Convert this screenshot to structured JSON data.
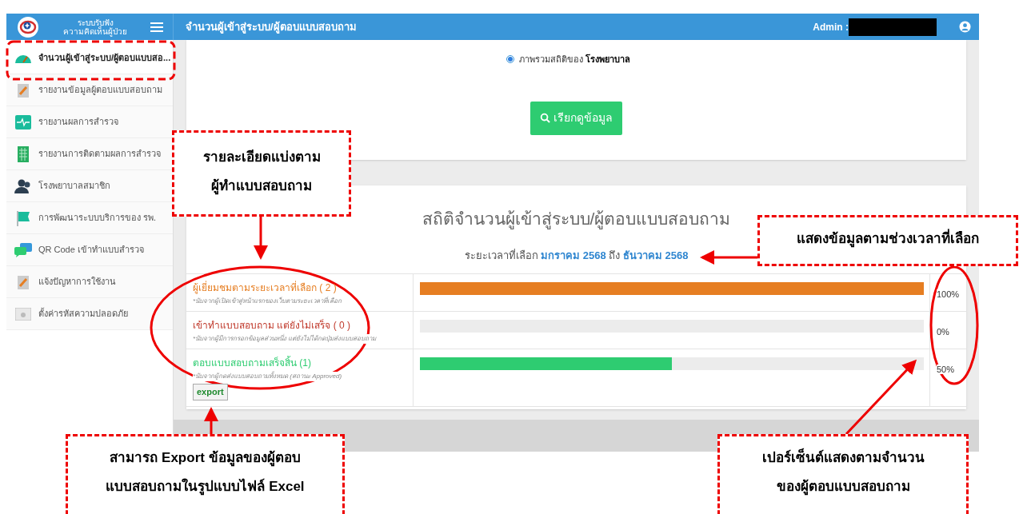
{
  "header": {
    "app_name": [
      "ระบบรับฟัง",
      "ความคิดเห็นผู้ป่วย"
    ],
    "title": "จำนวนผู้เข้าสู่ระบบ/ผู้ตอบแบบสอบถาม",
    "admin_label": "Admin :"
  },
  "sidebar": {
    "items": [
      {
        "label": "จำนวนผู้เข้าสู่ระบบ/ผู้ตอบแบบสอ...",
        "selected": true
      },
      {
        "label": "รายงานข้อมูลผู้ตอบแบบสอบถาม",
        "selected": false
      },
      {
        "label": "รายงานผลการสำรวจ",
        "selected": false
      },
      {
        "label": "รายงานการติดตามผลการสำรวจ",
        "selected": false
      },
      {
        "label": "โรงพยาบาลสมาชิก",
        "selected": false
      },
      {
        "label": "การพัฒนาระบบบริการของ รพ.",
        "selected": false
      },
      {
        "label": "QR Code เข้าทำแบบสำรวจ",
        "selected": false
      },
      {
        "label": "แจ้งปัญหาการใช้งาน",
        "selected": false
      },
      {
        "label": "ตั้งค่ารหัสความปลอดภัย",
        "selected": false
      }
    ]
  },
  "filter": {
    "option": {
      "label": "ภาพรวมสถิติของ **โรงพยาบาล**",
      "selected": true
    },
    "button": "เรียกดูข้อมูล"
  },
  "stats": {
    "title": "สถิติจำนวนผู้เข้าสู่ระบบ/ผู้ตอบแบบสอบถาม",
    "period": "ระยะเวลาที่เลือก **มกราคม 2568** ถึง **ธันวาคม 2568**",
    "rows": [
      {
        "label": "ผู้เยี่ยมชมตามระยะเวลาที่เลือก ( 2 )",
        "note": "*นับจากผู้เปิดเข้าสู่หน้าแรกของเว็บตามระยะเวลาที่เลือก",
        "color": "#e67e22",
        "level": 1,
        "percent": "100%"
      },
      {
        "label": "เข้าทำแบบสอบถาม แต่ยังไม่เสร็จ ( 0 )",
        "note": "*นับจากผู้มีการกรอกข้อมูลส่วนหนึ่ง แต่ยังไม่ได้กดปุ่มส่งแบบสอบถาม",
        "color": "#c0392b",
        "level": 0,
        "percent": "0%"
      },
      {
        "label": "ตอบแบบสอบถามเสร็จสิ้น (1)",
        "note": "*นับจากผู้กดส่งแบบสอบถามทั้งหมด (สถานะ Approved)",
        "color": "#2ecc71",
        "level": 0.5,
        "percent": "50%",
        "export": "export"
      }
    ]
  },
  "annotations": [
    {
      "lines": [
        "รายละเอียดแบ่งตาม",
        "ผู้ทำแบบสอบถาม"
      ]
    },
    {
      "lines": [
        "แสดงข้อมูลตามช่วงเวลาที่เลือก"
      ]
    },
    {
      "lines": [
        "สามารถ Export ข้อมูลของผู้ตอบ",
        "แบบสอบถามในรูปแบบไฟล์ Excel"
      ]
    },
    {
      "lines": [
        "เปอร์เซ็นต์แสดงตามจำนวน",
        "ของผู้ตอบแบบสอบถาม"
      ]
    }
  ]
}
